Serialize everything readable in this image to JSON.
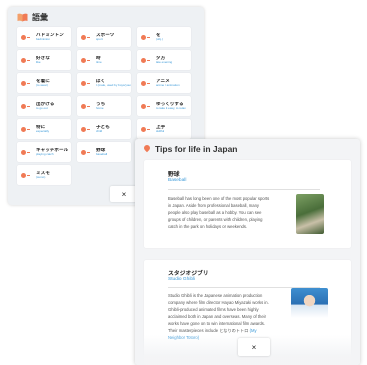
{
  "vocab_panel": {
    "title": "語彙",
    "close_label": "×",
    "cards": [
      {
        "jp": "バドミントン",
        "en": "badminton"
      },
      {
        "jp": "スポーツ",
        "en": "sport"
      },
      {
        "jp": "を",
        "en": "(obj.)"
      },
      {
        "jp": "好きな",
        "en": "like"
      },
      {
        "jp": "時",
        "en": "time"
      },
      {
        "jp": "夕方",
        "en": "late evening"
      },
      {
        "jp": "を着に",
        "en": "(to wear)"
      },
      {
        "jp": "ぼく",
        "en": "I (male, used by boys/young men)"
      },
      {
        "jp": "アニメ",
        "en": "anime / animation"
      },
      {
        "jp": "出かける",
        "en": "to go out"
      },
      {
        "jp": "うち",
        "en": "home"
      },
      {
        "jp": "ゆっくりする",
        "en": "to take it easy, to relax"
      },
      {
        "jp": "特に",
        "en": "especially"
      },
      {
        "jp": "子ども",
        "en": "child"
      },
      {
        "jp": "上手",
        "en": "skillful"
      },
      {
        "jp": "キャッチボール",
        "en": "playing catch"
      },
      {
        "jp": "野球",
        "en": "baseball"
      },
      {
        "jp": "",
        "en": ""
      },
      {
        "jp": "ミスモ",
        "en": "(sumo)"
      }
    ]
  },
  "tips_panel": {
    "title": "Tips for life in Japan",
    "close_label": "×",
    "items": [
      {
        "name_jp": "野球",
        "name_en": "Baseball",
        "body": "Baseball has long been one of the most popular sports in Japan. Aside from professional baseball, many people also play baseball as a hobby. You can see groups of children, or parents with children, playing catch in the park on holidays or weekends."
      },
      {
        "name_jp": "スタジオジブリ",
        "name_en": "Studio Ghibli",
        "body": "Studio Ghibli is the Japanese animation production company where film director Hayao Miyazaki works in. Ghibli-produced animated films have been highly acclaimed both in Japan and overseas. Many of their works have gone on to win international film awards. Their masterpieces include となりのトトロ",
        "link": "(My Neighbor Totoro)"
      }
    ]
  },
  "colors": {
    "accent": "#f07a55",
    "link": "#3d9ad8"
  }
}
